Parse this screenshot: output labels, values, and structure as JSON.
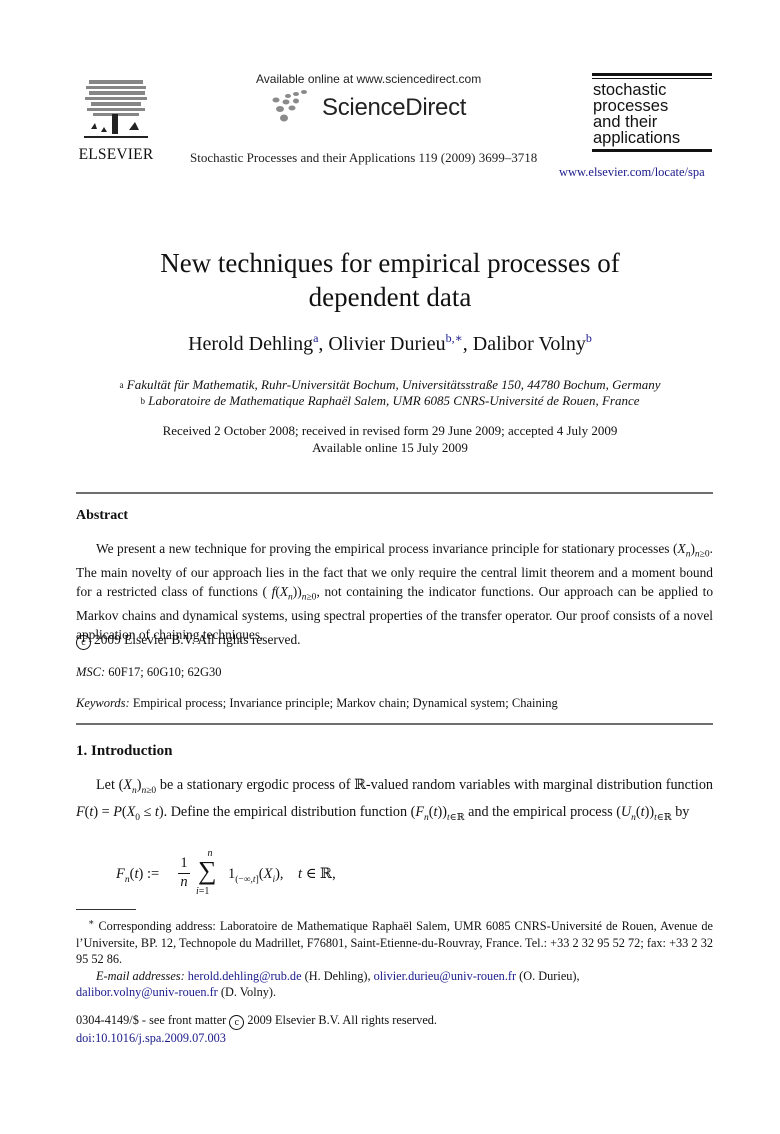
{
  "header": {
    "publisher_logo_text": "ELSEVIER",
    "sciencedirect_available": "Available online at www.sciencedirect.com",
    "sciencedirect_brand": "ScienceDirect",
    "journal_citation": "Stochastic Processes and their Applications 119 (2009) 3699–3718",
    "journal_logo_lines": [
      "stochastic",
      "processes",
      "and their",
      "applications"
    ],
    "journal_url": "www.elsevier.com/locate/spa"
  },
  "article": {
    "title_line1": "New techniques for empirical processes of",
    "title_line2": "dependent data",
    "authors": [
      {
        "name": "Herold Dehling",
        "mark": "a"
      },
      {
        "name": "Olivier Durieu",
        "mark": "b,∗"
      },
      {
        "name": "Dalibor Volny",
        "mark": "b"
      }
    ],
    "affiliations": [
      {
        "mark": "a",
        "text": "Fakultät für Mathematik, Ruhr-Universität Bochum, Universitätsstraße 150, 44780 Bochum, Germany"
      },
      {
        "mark": "b",
        "text": "Laboratoire de Mathematique Raphaël Salem, UMR 6085 CNRS-Université de Rouen, France"
      }
    ],
    "received": "Received 2 October 2008; received in revised form 29 June 2009; accepted 4 July 2009",
    "available_online": "Available online 15 July 2009"
  },
  "abstract": {
    "heading": "Abstract",
    "p1": "We present a new technique for proving the empirical process invariance principle for stationary processes ",
    "p2": ". The main novelty of our approach lies in the fact that we only require the central limit theorem and a moment bound for a restricted class of functions ",
    "p3": ", not containing the indicator functions. Our approach can be applied to Markov chains and dynamical systems, using spectral properties of the transfer operator. Our proof consists of a novel application of chaining techniques.",
    "copyright": "2009 Elsevier B.V. All rights reserved.",
    "msc_label": "MSC:",
    "msc_codes": "60F17; 60G10; 62G30",
    "keywords_label": "Keywords:",
    "keywords": "Empirical process; Invariance principle; Markov chain; Dynamical system; Chaining"
  },
  "intro": {
    "heading": "1.  Introduction",
    "t1": "Let ",
    "t2": " be a stationary ergodic process of ℝ-valued random variables with marginal distribution function ",
    "t3": ". Define the empirical distribution function ",
    "t4": " and the empirical process ",
    "t5": " by"
  },
  "footnote": {
    "mark": "∗",
    "corresponding": "Corresponding address: Laboratoire de Mathematique Raphaël Salem, UMR 6085 CNRS-Université de Rouen, Avenue de l’Universite, BP. 12, Technopole du Madrillet, F76801, Saint-Etienne-du-Rouvray, France. Tel.: +33 2 32 95 52 72; fax: +33 2 32 95 52 86.",
    "email_label": "E-mail addresses:",
    "emails": [
      {
        "address": "herold.dehling@rub.de",
        "who": "(H. Dehling),"
      },
      {
        "address": "olivier.durieu@univ-rouen.fr",
        "who": "(O. Durieu),"
      },
      {
        "address": "dalibor.volny@univ-rouen.fr",
        "who": "(D. Volny)."
      }
    ]
  },
  "footer": {
    "issn_line_a": "0304-4149/$ - see front matter",
    "issn_line_b": "2009 Elsevier B.V. All rights reserved.",
    "doi": "doi:10.1016/j.spa.2009.07.003"
  }
}
